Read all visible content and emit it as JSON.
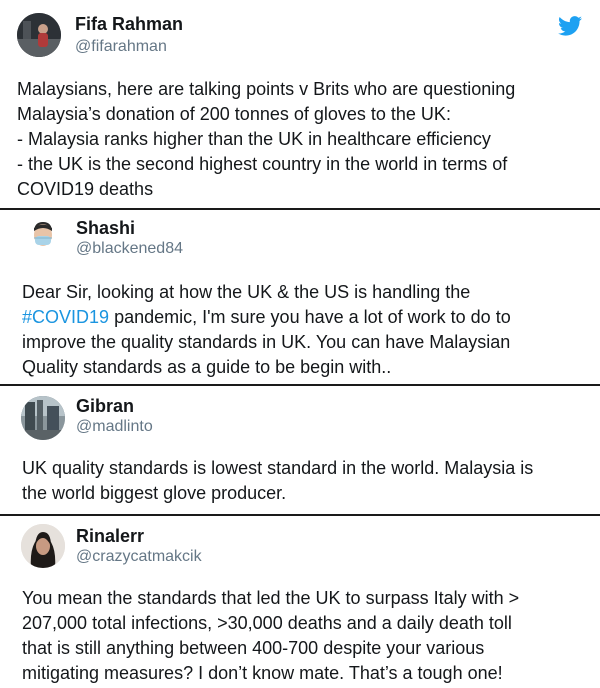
{
  "colors": {
    "text": "#14171a",
    "handle": "#657786",
    "link": "#1b95e0",
    "twitter_blue": "#1da1f2",
    "divider": "#1a1a1a"
  },
  "tweets": [
    {
      "name": "Fifa Rahman",
      "handle": "@fifarahman",
      "icon": "twitter-bird-icon",
      "lines": [
        "Malaysians, here are talking points v Brits who are questioning",
        "Malaysia’s donation of 200 tonnes of gloves to the UK:",
        "- Malaysia ranks higher than the UK in healthcare efficiency",
        "- the UK is the second highest country in the world in terms of",
        "COVID19 deaths"
      ]
    },
    {
      "name": "Shashi",
      "handle": "@blackened84",
      "lines": [
        "Dear Sir, looking at how the UK & the US is handling the",
        "pandemic, I'm sure you have a lot of work to do to",
        "improve the quality standards in UK. You can have Malaysian",
        "Quality standards as a guide to be begin with.."
      ],
      "hashtag": "#COVID19"
    },
    {
      "name": "Gibran",
      "handle": "@madlinto",
      "lines": [
        "UK quality standards is lowest standard in the world. Malaysia is",
        "the world biggest glove producer."
      ]
    },
    {
      "name": "Rinalerr",
      "handle": "@crazycatmakcik",
      "lines": [
        "You mean the standards that led the UK to surpass Italy with >",
        "207,000 total infections, >30,000 deaths and a daily death toll",
        "that is still anything between 400-700 despite your various",
        "mitigating measures? I don’t know mate. That’s a tough one!"
      ]
    }
  ]
}
